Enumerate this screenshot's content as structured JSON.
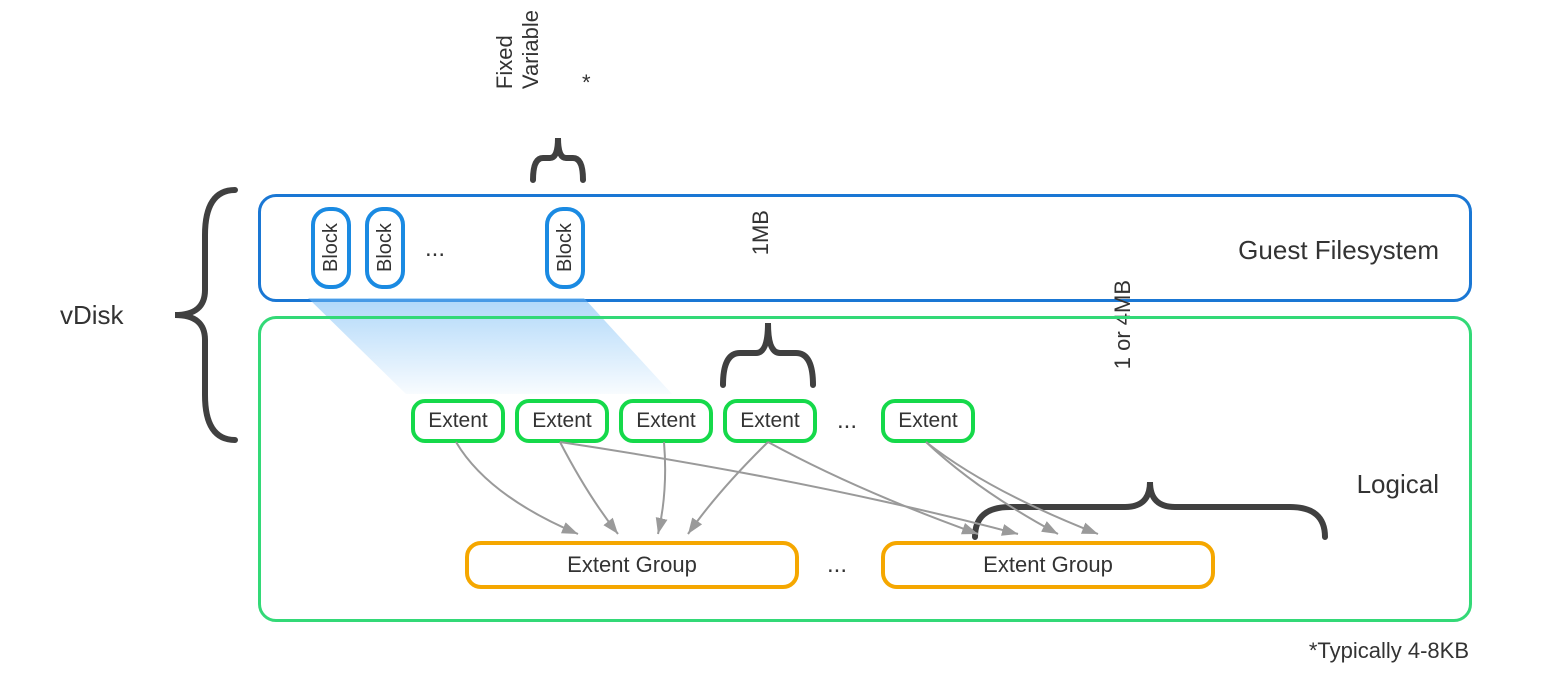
{
  "vdisk_label": "vDisk",
  "guest": {
    "title": "Guest Filesystem",
    "blocks": [
      "Block",
      "Block",
      "Block"
    ],
    "block_dots": "...",
    "size_type": {
      "line1": "Fixed",
      "line2": "Variable",
      "asterisk": "*"
    }
  },
  "logical": {
    "title": "Logical",
    "extents": [
      "Extent",
      "Extent",
      "Extent",
      "Extent",
      "Extent"
    ],
    "extent_dots": "...",
    "extent_size": "1MB",
    "extent_groups": [
      "Extent Group",
      "Extent Group"
    ],
    "eg_dots": "...",
    "eg_size": "1 or 4MB"
  },
  "footnote": "*Typically 4-8KB"
}
